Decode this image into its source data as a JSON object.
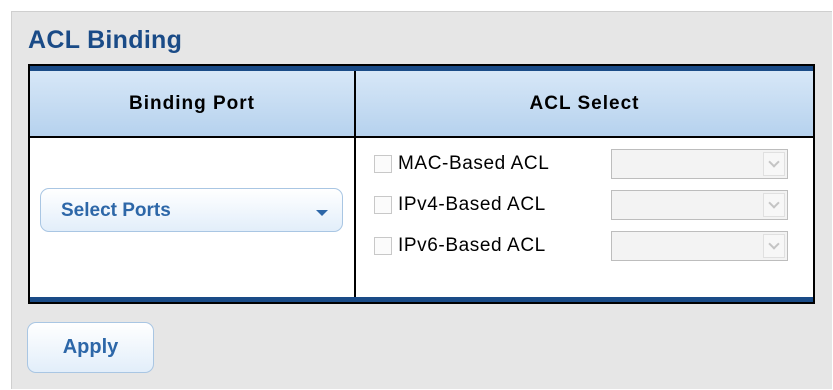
{
  "page": {
    "title": "ACL Binding"
  },
  "table": {
    "headers": {
      "binding_port": "Binding Port",
      "acl_select": "ACL Select"
    },
    "port_selector": {
      "label": "Select Ports",
      "icon": "chevron-down-icon"
    },
    "acl_rows": [
      {
        "label": "MAC-Based ACL",
        "checked": false,
        "selected_value": ""
      },
      {
        "label": "IPv4-Based ACL",
        "checked": false,
        "selected_value": ""
      },
      {
        "label": "IPv6-Based ACL",
        "checked": false,
        "selected_value": ""
      }
    ]
  },
  "actions": {
    "apply_label": "Apply"
  },
  "colors": {
    "title": "#1a4b87",
    "accent_bar": "#1a4b87",
    "header_bg": "#c6dcf2",
    "button_text": "#2d67a8",
    "panel_bg": "#e6e6e6"
  }
}
